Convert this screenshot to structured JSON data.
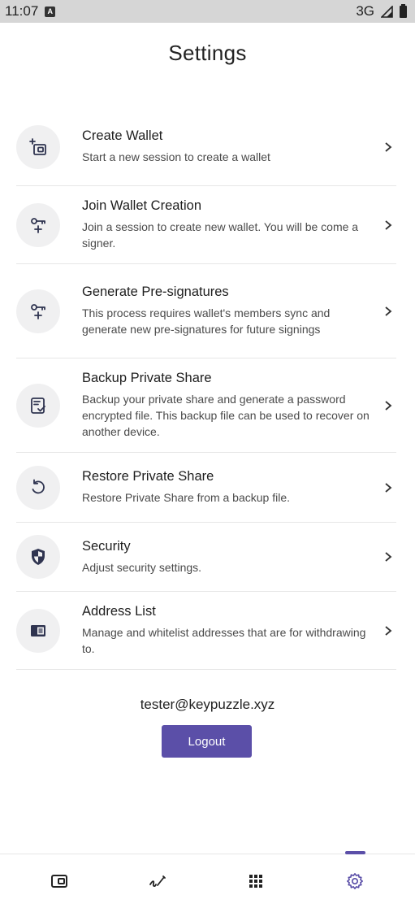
{
  "status_bar": {
    "time": "11:07",
    "notification_glyph": "A",
    "network": "3G"
  },
  "page": {
    "title": "Settings"
  },
  "menu": [
    {
      "title": "Create Wallet",
      "desc": "Start a new session to create a wallet",
      "icon": "add-wallet-icon"
    },
    {
      "title": "Join Wallet Creation",
      "desc": "Join a session to create new wallet. You will be come a signer.",
      "icon": "key-plus-icon"
    },
    {
      "title": "Generate Pre-signatures",
      "desc": "This process requires wallet's members sync and generate new pre-signatures for future signings",
      "icon": "key-plus-icon"
    },
    {
      "title": "Backup Private Share",
      "desc": "Backup your private share and generate a password encrypted file. This backup file can be used to recover on another device.",
      "icon": "backup-file-icon"
    },
    {
      "title": "Restore Private Share",
      "desc": "Restore Private Share from a backup file.",
      "icon": "restore-icon"
    },
    {
      "title": "Security",
      "desc": "Adjust security settings.",
      "icon": "shield-icon"
    },
    {
      "title": "Address List",
      "desc": "Manage and whitelist addresses that are for withdrawing to.",
      "icon": "address-card-icon"
    }
  ],
  "account": {
    "email": "tester@keypuzzle.xyz",
    "logout_label": "Logout"
  },
  "colors": {
    "accent": "#5b4fa8",
    "icon_bg": "#f0f0f1",
    "divider": "#e6e6e6"
  },
  "bottom_nav": [
    {
      "icon": "wallet-icon",
      "active": false
    },
    {
      "icon": "signature-icon",
      "active": false
    },
    {
      "icon": "apps-grid-icon",
      "active": false
    },
    {
      "icon": "gear-icon",
      "active": true
    }
  ]
}
